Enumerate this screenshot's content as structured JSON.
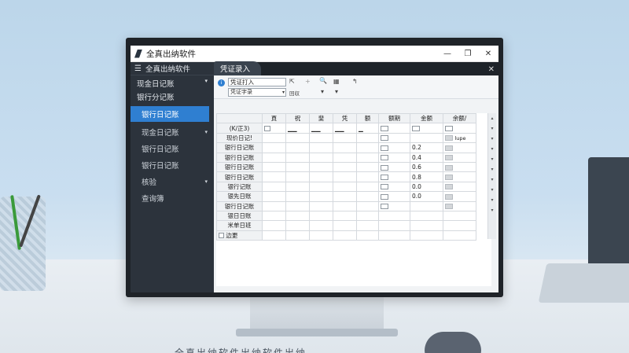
{
  "window": {
    "title": "全真出纳软件",
    "controls": [
      "—",
      "❐",
      "✕"
    ]
  },
  "sidebar": {
    "header": "全真出纳软件",
    "sections": [
      {
        "label": "现金日记账",
        "expanded": true
      },
      {
        "label": "银行分记账"
      }
    ],
    "items": [
      {
        "label": "银行日记账",
        "active": true
      },
      {
        "label": "现金日记账",
        "arrow": true
      },
      {
        "label": "银行日记账"
      },
      {
        "label": "银行日记账"
      },
      {
        "label": "核验",
        "arrow": true
      },
      {
        "label": "查询簿"
      }
    ]
  },
  "tabs": [
    {
      "label": "凭证录入"
    }
  ],
  "toolbar": {
    "input_value": "凭证打入",
    "select_value": "凭证字录",
    "btn1": "⇱",
    "btn2": "+",
    "btn3": "🔍",
    "btn4": "▦",
    "btn5": "↰",
    "sub1": "回収",
    "sub2": "▾",
    "sub3": "▾"
  },
  "grid": {
    "columns": [
      "",
      "頁",
      "祝",
      "斐",
      "凭",
      "额",
      "额期",
      "金额",
      "余额/"
    ],
    "header_row2": [
      "(K/正3)",
      "",
      "",
      "",
      "",
      "",
      "",
      "",
      ""
    ],
    "rows": [
      {
        "label": "现价日记!",
        "amount": "",
        "extra": "lupe"
      },
      {
        "label": "银行日记账",
        "amount": "0.2",
        "extra": ""
      },
      {
        "label": "银行日记账",
        "amount": "0.4",
        "extra": ""
      },
      {
        "label": "银行日记账",
        "amount": "0.6",
        "extra": ""
      },
      {
        "label": "银行日记账",
        "amount": "0.8",
        "extra": ""
      },
      {
        "label": "银行记账",
        "amount": "0.0",
        "extra": ""
      },
      {
        "label": "银先日账",
        "amount": "0.0",
        "extra": ""
      },
      {
        "label": "银行日记账",
        "amount": "",
        "extra": ""
      },
      {
        "label": "银日日账",
        "amount": "",
        "extra": ""
      },
      {
        "label": "米单日班",
        "amount": "",
        "extra": ""
      }
    ],
    "footer_label": "边更"
  },
  "bottom_text": "全真出纳软件出纳软件出纳…",
  "colors": {
    "accent": "#2f7fd1",
    "sidebar_bg": "#2c333c"
  }
}
